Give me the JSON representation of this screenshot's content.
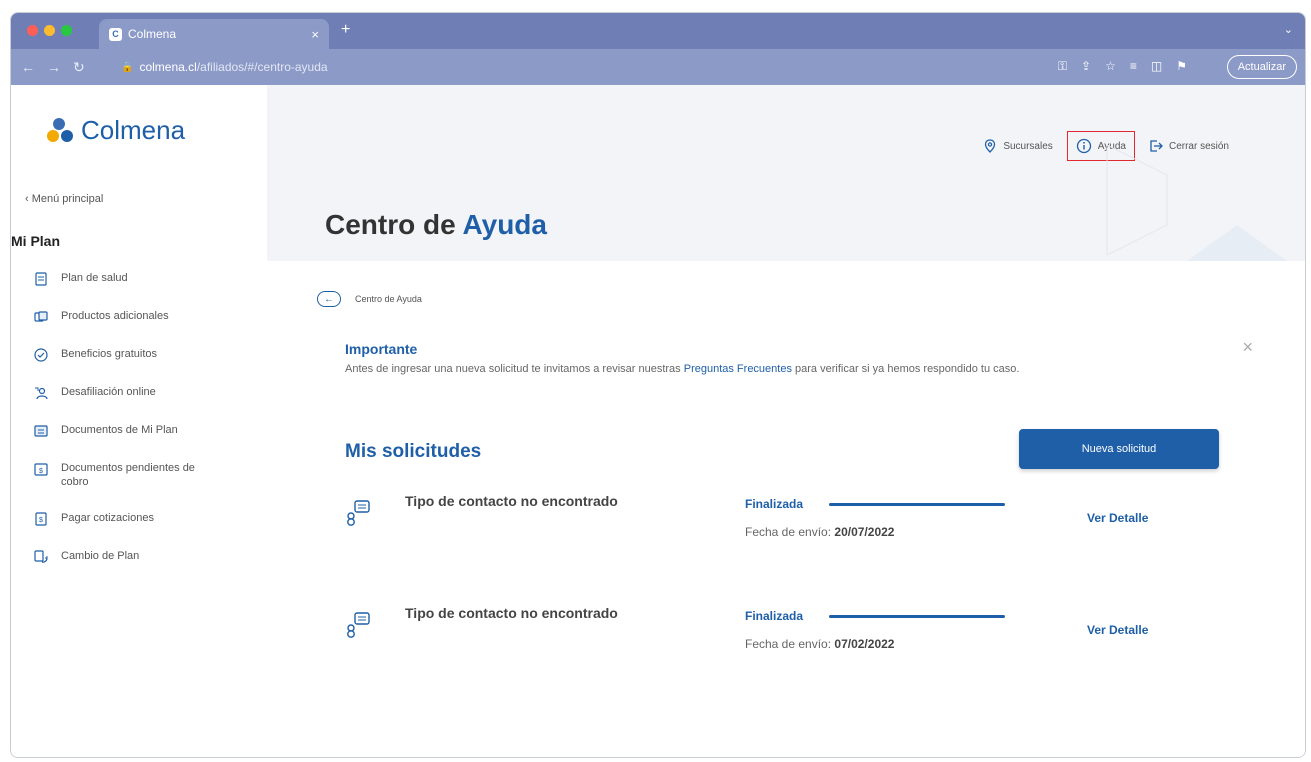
{
  "browser": {
    "tab_title": "Colmena",
    "url_host": "colmena.cl",
    "url_path": "/afiliados/#/centro-ayuda",
    "update_label": "Actualizar"
  },
  "brand": {
    "name": "Colmena",
    "color": "#1f5fa8"
  },
  "sidebar": {
    "back_label": "‹ Menú principal",
    "section_title": "Mi Plan",
    "items": [
      {
        "label": "Plan de salud",
        "icon": "document-icon"
      },
      {
        "label": "Productos adicionales",
        "icon": "layers-icon"
      },
      {
        "label": "Beneficios gratuitos",
        "icon": "check-circle-icon"
      },
      {
        "label": "Desafiliación online",
        "icon": "person-leave-icon"
      },
      {
        "label": "Documentos de Mi Plan",
        "icon": "folder-doc-icon"
      },
      {
        "label": "Documentos pendientes de cobro",
        "icon": "pending-doc-icon"
      },
      {
        "label": "Pagar cotizaciones",
        "icon": "payment-doc-icon"
      },
      {
        "label": "Cambio de Plan",
        "icon": "swap-icon"
      }
    ]
  },
  "header": {
    "links": {
      "branches": "Sucursales",
      "help": "Ayuda",
      "logout": "Cerrar sesión"
    }
  },
  "page": {
    "title_prefix": "Centro de",
    "title_accent": "Ayuda",
    "breadcrumb": "Centro de Ayuda"
  },
  "notice": {
    "title": "Importante",
    "text_before": "Antes de ingresar una nueva solicitud te invitamos a revisar nuestras ",
    "link": "Preguntas Frecuentes",
    "text_after": " para verificar si ya hemos respondido tu caso."
  },
  "requests": {
    "title": "Mis solicitudes",
    "new_button": "Nueva solicitud",
    "date_label": "Fecha de envío:",
    "detail_label": "Ver Detalle",
    "items": [
      {
        "type": "Tipo de contacto no encontrado",
        "status": "Finalizada",
        "date": "20/07/2022"
      },
      {
        "type": "Tipo de contacto no encontrado",
        "status": "Finalizada",
        "date": "07/02/2022"
      }
    ]
  }
}
